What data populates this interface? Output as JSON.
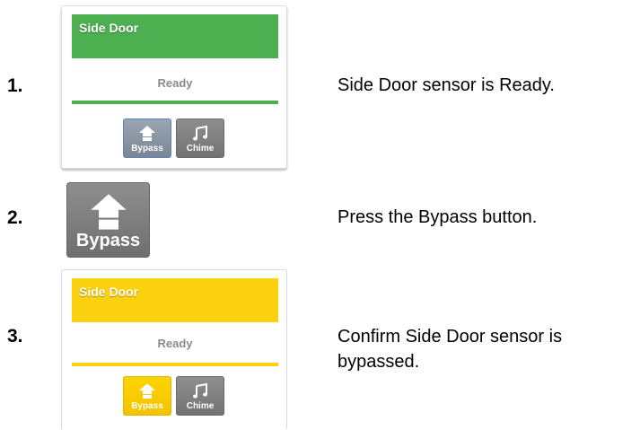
{
  "steps": [
    {
      "number": "1.",
      "description": "Side Door sensor is Ready.",
      "card": {
        "title": "Side Door",
        "status": "Ready",
        "header_color": "#4caf50",
        "line_color": "#4caf50",
        "buttons": [
          {
            "label": "Bypass",
            "icon": "bypass-icon",
            "state": "default"
          },
          {
            "label": "Chime",
            "icon": "chime-icon",
            "state": "default"
          }
        ]
      }
    },
    {
      "number": "2.",
      "description": "Press the Bypass button.",
      "button": {
        "label": "Bypass",
        "icon": "bypass-icon"
      }
    },
    {
      "number": "3.",
      "description": "Confirm Side Door sensor is bypassed.",
      "card": {
        "title": "Side Door",
        "status": "Ready",
        "header_color": "#fcd10f",
        "line_color": "#fcd10f",
        "buttons": [
          {
            "label": "Bypass",
            "icon": "bypass-icon",
            "state": "active"
          },
          {
            "label": "Chime",
            "icon": "chime-icon",
            "state": "default"
          }
        ]
      }
    }
  ]
}
